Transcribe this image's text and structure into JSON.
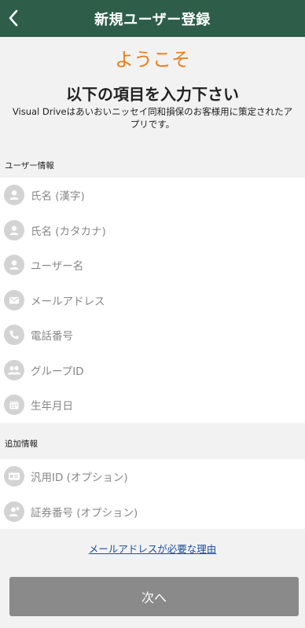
{
  "header": {
    "title": "新規ユーザー登録",
    "back_icon": "chevron-left-icon"
  },
  "welcome": "ようこそ",
  "heading": "以下の項目を入力下さい",
  "intro": "Visual Driveはあいおいニッセイ同和損保のお客様用に策定されたアプリです。",
  "sections": {
    "user_info": {
      "label": "ユーザー情報",
      "fields": [
        {
          "icon": "person-icon",
          "placeholder": "氏名 (漢字)"
        },
        {
          "icon": "person-icon",
          "placeholder": "氏名 (カタカナ)"
        },
        {
          "icon": "person-icon",
          "placeholder": "ユーザー名"
        },
        {
          "icon": "envelope-icon",
          "placeholder": "メールアドレス"
        },
        {
          "icon": "phone-icon",
          "placeholder": "電話番号"
        },
        {
          "icon": "group-icon",
          "placeholder": "グループID"
        },
        {
          "icon": "calendar-icon",
          "placeholder": "生年月日"
        }
      ]
    },
    "additional_info": {
      "label": "追加情報",
      "fields": [
        {
          "icon": "id-card-icon",
          "placeholder": "汎用ID (オプション)"
        },
        {
          "icon": "person-badge-icon",
          "placeholder": "証券番号 (オプション)"
        }
      ]
    }
  },
  "reason_link": "メールアドレスが必要な理由",
  "next_button": "次へ",
  "colors": {
    "header_bg": "#2e5e4a",
    "accent_orange": "#e87f1e",
    "link_blue": "#1d4f9e",
    "button_gray": "#8a8a8a"
  }
}
